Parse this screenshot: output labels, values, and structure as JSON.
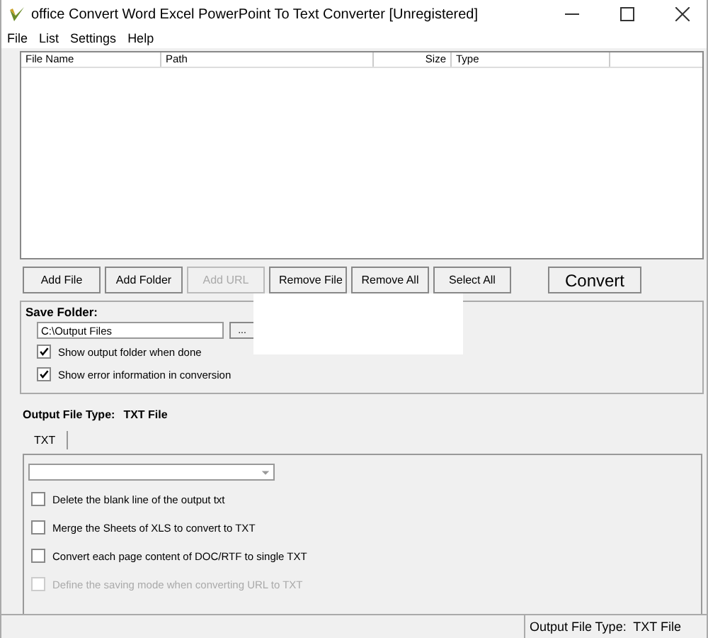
{
  "window": {
    "title": "office Convert Word Excel PowerPoint To Text Converter [Unregistered]"
  },
  "menu": [
    "File",
    "List",
    "Settings",
    "Help"
  ],
  "file_list": {
    "columns": [
      "File Name",
      "Path",
      "Size",
      "Type"
    ]
  },
  "buttons": [
    {
      "label": "Add File",
      "disabled": false
    },
    {
      "label": "Add Folder",
      "disabled": false
    },
    {
      "label": "Add URL",
      "disabled": true
    },
    {
      "label": "Remove File",
      "disabled": false
    },
    {
      "label": "Remove All",
      "disabled": false
    },
    {
      "label": "Select All",
      "disabled": false
    }
  ],
  "convert_button": "Convert",
  "save_folder": {
    "title": "Save Folder:",
    "path": "C:\\Output Files",
    "browse": "...",
    "options": [
      {
        "label": "Show output folder when done",
        "checked": true
      },
      {
        "label": "Show error information in conversion",
        "checked": true
      }
    ]
  },
  "output_type": {
    "label": "Output File Type:",
    "value": "TXT File"
  },
  "tabs": [
    {
      "label": "TXT",
      "selected": true
    }
  ],
  "txt_options": [
    {
      "label": "Delete the blank line of the output txt",
      "checked": false,
      "disabled": false
    },
    {
      "label": "Merge the Sheets of XLS to convert to TXT",
      "checked": false,
      "disabled": false
    },
    {
      "label": "Convert each page content of DOC/RTF to single TXT",
      "checked": false,
      "disabled": false
    },
    {
      "label": "Define the saving mode when converting URL to TXT",
      "checked": false,
      "disabled": true
    }
  ],
  "status_bar": {
    "text": "Output File Type:  TXT File"
  }
}
